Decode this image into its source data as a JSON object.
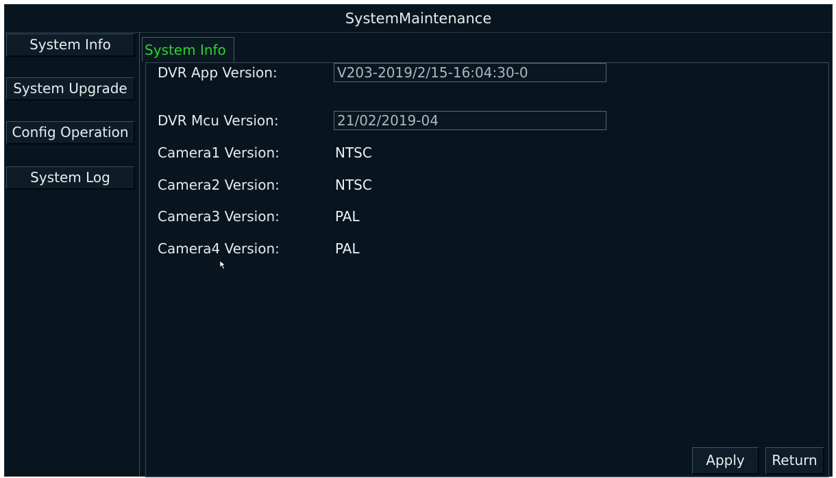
{
  "window": {
    "title": "SystemMaintenance"
  },
  "sidebar": {
    "items": [
      {
        "label": "System Info"
      },
      {
        "label": "System Upgrade"
      },
      {
        "label": "Config Operation"
      },
      {
        "label": "System Log"
      }
    ]
  },
  "main": {
    "tabs": [
      {
        "label": "System Info",
        "active": true,
        "color": "#2fd32f"
      }
    ],
    "fields": [
      {
        "label": "DVR App Version:",
        "value": "V203-2019/2/15-16:04:30-0"
      },
      {
        "label": "DVR Mcu Version:",
        "value": "21/02/2019-04"
      },
      {
        "label": "Camera1 Version:",
        "value": "NTSC"
      },
      {
        "label": "Camera2 Version:",
        "value": "NTSC"
      },
      {
        "label": "Camera3 Version:",
        "value": "PAL"
      },
      {
        "label": "Camera4 Version:",
        "value": "PAL"
      }
    ]
  },
  "actions": {
    "apply_label": "Apply",
    "return_label": "Return"
  },
  "cursor": {
    "icon": "mouse-pointer-icon"
  },
  "colors": {
    "background": "#08151e",
    "text": "#e6eaec",
    "active_tab": "#2fd32f"
  }
}
